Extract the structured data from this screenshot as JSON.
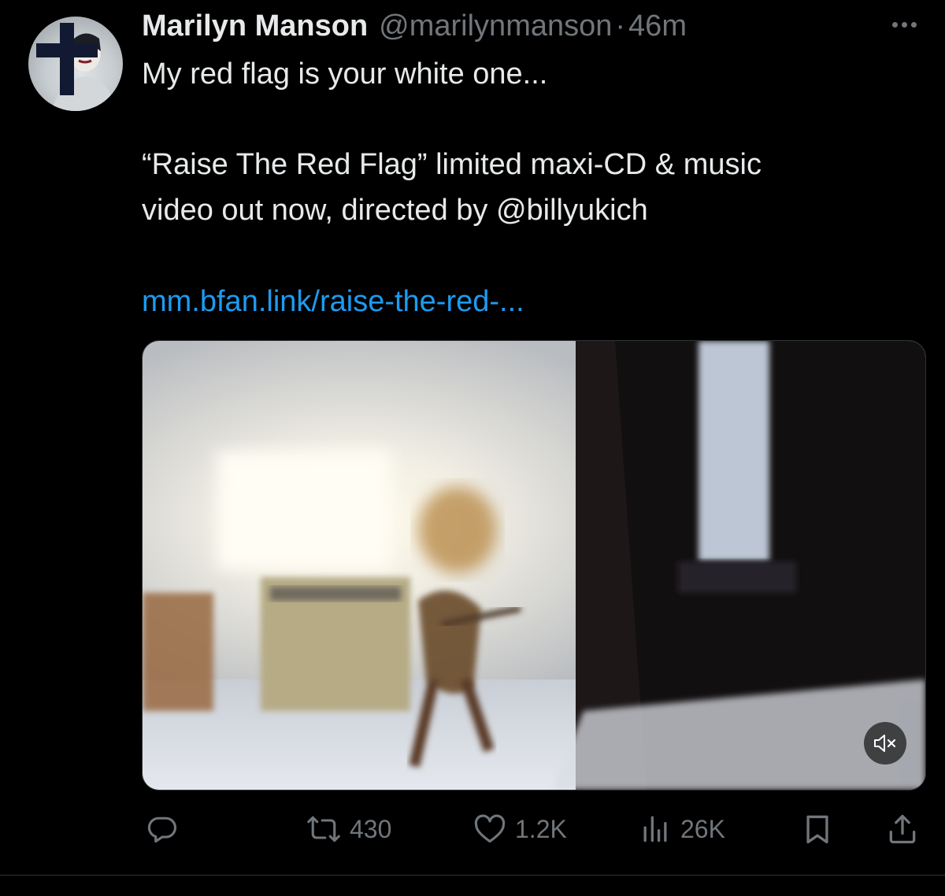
{
  "tweet": {
    "author": {
      "name": "Marilyn Manson",
      "handle": "@marilynmanson",
      "separator": "·",
      "time": "46m"
    },
    "text": {
      "line1": "My red flag is your white one...",
      "line2": "“Raise The Red Flag” limited maxi-CD & music",
      "line3": "video out now, directed by @billyukich",
      "link": "mm.bfan.link/raise-the-red-..."
    },
    "media": {
      "type": "video",
      "muted_icon": "speaker-muted-icon"
    },
    "actions": {
      "reply_icon": "comment-icon",
      "retweet_icon": "retweet-icon",
      "retweets": "430",
      "like_icon": "heart-icon",
      "likes": "1.2K",
      "views_icon": "bar-chart-icon",
      "views": "26K",
      "bookmark_icon": "bookmark-icon",
      "share_icon": "share-icon"
    }
  },
  "colors": {
    "background": "#000000",
    "text_primary": "#e7e9ea",
    "text_secondary": "#71767b",
    "link": "#1d9bf0"
  }
}
